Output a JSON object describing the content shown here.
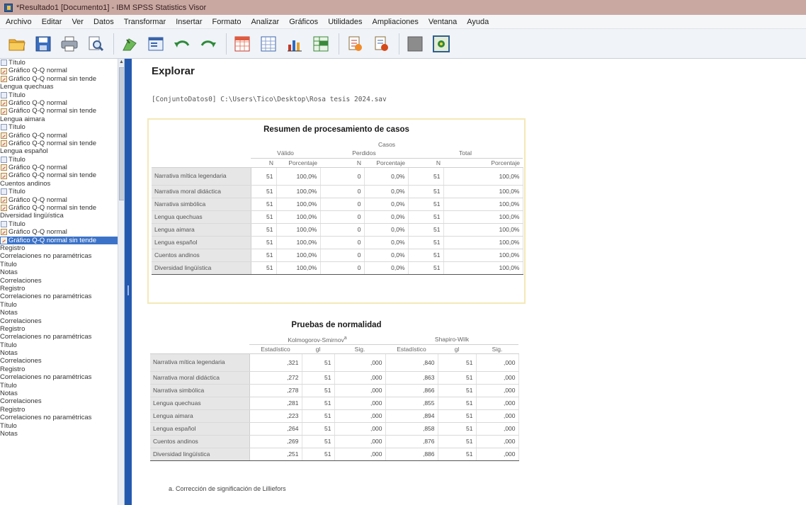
{
  "window": {
    "title": "*Resultado1 [Documento1] - IBM SPSS Statistics Visor"
  },
  "menu": [
    "Archivo",
    "Editar",
    "Ver",
    "Datos",
    "Transformar",
    "Insertar",
    "Formato",
    "Analizar",
    "Gráficos",
    "Utilidades",
    "Ampliaciones",
    "Ventana",
    "Ayuda"
  ],
  "toolbar": {
    "icons": [
      "open-folder-icon",
      "save-icon",
      "print-icon",
      "print-preview-icon",
      "export-icon",
      "recall-dialog-icon",
      "undo-icon",
      "redo-icon",
      "goto-data-icon",
      "goto-case-icon",
      "variables-icon",
      "designate-window-icon",
      "show-output-icon",
      "hide-output-icon",
      "insert-heading-icon",
      "insert-output-icon"
    ]
  },
  "outline": {
    "items": [
      {
        "label": "Título",
        "kind": "title"
      },
      {
        "label": "Gráfico Q-Q normal",
        "kind": "graph"
      },
      {
        "label": "Gráfico Q-Q normal sin tende",
        "kind": "graph"
      },
      {
        "label": "Lengua quechuas",
        "kind": "heading"
      },
      {
        "label": "Título",
        "kind": "title"
      },
      {
        "label": "Gráfico Q-Q normal",
        "kind": "graph"
      },
      {
        "label": "Gráfico Q-Q normal sin tende",
        "kind": "graph"
      },
      {
        "label": "Lengua aimara",
        "kind": "heading"
      },
      {
        "label": "Título",
        "kind": "title"
      },
      {
        "label": "Gráfico Q-Q normal",
        "kind": "graph"
      },
      {
        "label": "Gráfico Q-Q normal sin tende",
        "kind": "graph"
      },
      {
        "label": "Lengua español",
        "kind": "heading"
      },
      {
        "label": "Título",
        "kind": "title"
      },
      {
        "label": "Gráfico Q-Q normal",
        "kind": "graph"
      },
      {
        "label": "Gráfico Q-Q normal sin tende",
        "kind": "graph"
      },
      {
        "label": "Cuentos andinos",
        "kind": "heading"
      },
      {
        "label": "Título",
        "kind": "title"
      },
      {
        "label": "Gráfico Q-Q normal",
        "kind": "graph"
      },
      {
        "label": "Gráfico Q-Q normal sin tende",
        "kind": "graph"
      },
      {
        "label": "Diversidad lingüística",
        "kind": "heading"
      },
      {
        "label": "Título",
        "kind": "title"
      },
      {
        "label": "Gráfico Q-Q normal",
        "kind": "graph"
      },
      {
        "label": "Gráfico Q-Q normal sin tende",
        "kind": "graph",
        "selected": true
      },
      {
        "label": "Registro",
        "kind": "heading"
      },
      {
        "label": "Correlaciones no paramétricas",
        "kind": "heading"
      },
      {
        "label": "Título",
        "kind": "heading"
      },
      {
        "label": "Notas",
        "kind": "heading"
      },
      {
        "label": "Correlaciones",
        "kind": "heading"
      },
      {
        "label": "Registro",
        "kind": "heading"
      },
      {
        "label": "Correlaciones no paramétricas",
        "kind": "heading"
      },
      {
        "label": "Título",
        "kind": "heading"
      },
      {
        "label": "Notas",
        "kind": "heading"
      },
      {
        "label": "Correlaciones",
        "kind": "heading"
      },
      {
        "label": "Registro",
        "kind": "heading"
      },
      {
        "label": "Correlaciones no paramétricas",
        "kind": "heading"
      },
      {
        "label": "Título",
        "kind": "heading"
      },
      {
        "label": "Notas",
        "kind": "heading"
      },
      {
        "label": "Correlaciones",
        "kind": "heading"
      },
      {
        "label": "Registro",
        "kind": "heading"
      },
      {
        "label": "Correlaciones no paramétricas",
        "kind": "heading"
      },
      {
        "label": "Título",
        "kind": "heading"
      },
      {
        "label": "Notas",
        "kind": "heading"
      },
      {
        "label": "Correlaciones",
        "kind": "heading"
      },
      {
        "label": "Registro",
        "kind": "heading"
      },
      {
        "label": "Correlaciones no paramétricas",
        "kind": "heading"
      },
      {
        "label": "Título",
        "kind": "heading"
      },
      {
        "label": "Notas",
        "kind": "heading"
      }
    ]
  },
  "viewer": {
    "heading": "Explorar",
    "dataset": "[ConjuntoDatos0] C:\\Users\\Tico\\Desktop\\Rosa tesis 2024.sav"
  },
  "case_summary": {
    "title": "Resumen de procesamiento de casos",
    "group_header": "Casos",
    "col_groups": [
      "Válido",
      "Perdidos",
      "Total"
    ],
    "col_sub": [
      "N",
      "Porcentaje",
      "N",
      "Porcentaje",
      "N",
      "Porcentaje"
    ],
    "rows": [
      {
        "label": "Narrativa mítica legendaria",
        "values": [
          "51",
          "100,0%",
          "0",
          "0,0%",
          "51",
          "100,0%"
        ]
      },
      {
        "label": "Narrativa moral didáctica",
        "values": [
          "51",
          "100,0%",
          "0",
          "0,0%",
          "51",
          "100,0%"
        ]
      },
      {
        "label": "Narrativa simbólica",
        "values": [
          "51",
          "100,0%",
          "0",
          "0,0%",
          "51",
          "100,0%"
        ]
      },
      {
        "label": "Lengua quechuas",
        "values": [
          "51",
          "100,0%",
          "0",
          "0,0%",
          "51",
          "100,0%"
        ]
      },
      {
        "label": "Lengua aimara",
        "values": [
          "51",
          "100,0%",
          "0",
          "0,0%",
          "51",
          "100,0%"
        ]
      },
      {
        "label": "Lengua español",
        "values": [
          "51",
          "100,0%",
          "0",
          "0,0%",
          "51",
          "100,0%"
        ]
      },
      {
        "label": "Cuentos andinos",
        "values": [
          "51",
          "100,0%",
          "0",
          "0,0%",
          "51",
          "100,0%"
        ]
      },
      {
        "label": "Diversidad lingüística",
        "values": [
          "51",
          "100,0%",
          "0",
          "0,0%",
          "51",
          "100,0%"
        ]
      }
    ]
  },
  "normality": {
    "title": "Pruebas de normalidad",
    "col_groups": [
      "Kolmogorov-Smirnov",
      "Shapiro-Wilk"
    ],
    "group_marker": "a",
    "col_sub": [
      "Estadístico",
      "gl",
      "Sig.",
      "Estadístico",
      "gl",
      "Sig."
    ],
    "rows": [
      {
        "label": "Narrativa mítica legendaria",
        "values": [
          ",321",
          "51",
          ",000",
          ",840",
          "51",
          ",000"
        ]
      },
      {
        "label": "Narrativa moral didáctica",
        "values": [
          ",272",
          "51",
          ",000",
          ",863",
          "51",
          ",000"
        ]
      },
      {
        "label": "Narrativa simbólica",
        "values": [
          ",278",
          "51",
          ",000",
          ",866",
          "51",
          ",000"
        ]
      },
      {
        "label": "Lengua quechuas",
        "values": [
          ",281",
          "51",
          ",000",
          ",855",
          "51",
          ",000"
        ]
      },
      {
        "label": "Lengua aimara",
        "values": [
          ",223",
          "51",
          ",000",
          ",894",
          "51",
          ",000"
        ]
      },
      {
        "label": "Lengua español",
        "values": [
          ",264",
          "51",
          ",000",
          ",858",
          "51",
          ",000"
        ]
      },
      {
        "label": "Cuentos andinos",
        "values": [
          ",269",
          "51",
          ",000",
          ",876",
          "51",
          ",000"
        ]
      },
      {
        "label": "Diversidad lingüística",
        "values": [
          ",251",
          "51",
          ",000",
          ",886",
          "51",
          ",000"
        ]
      }
    ],
    "footnote": "a. Corrección de significación de Lilliefors"
  }
}
